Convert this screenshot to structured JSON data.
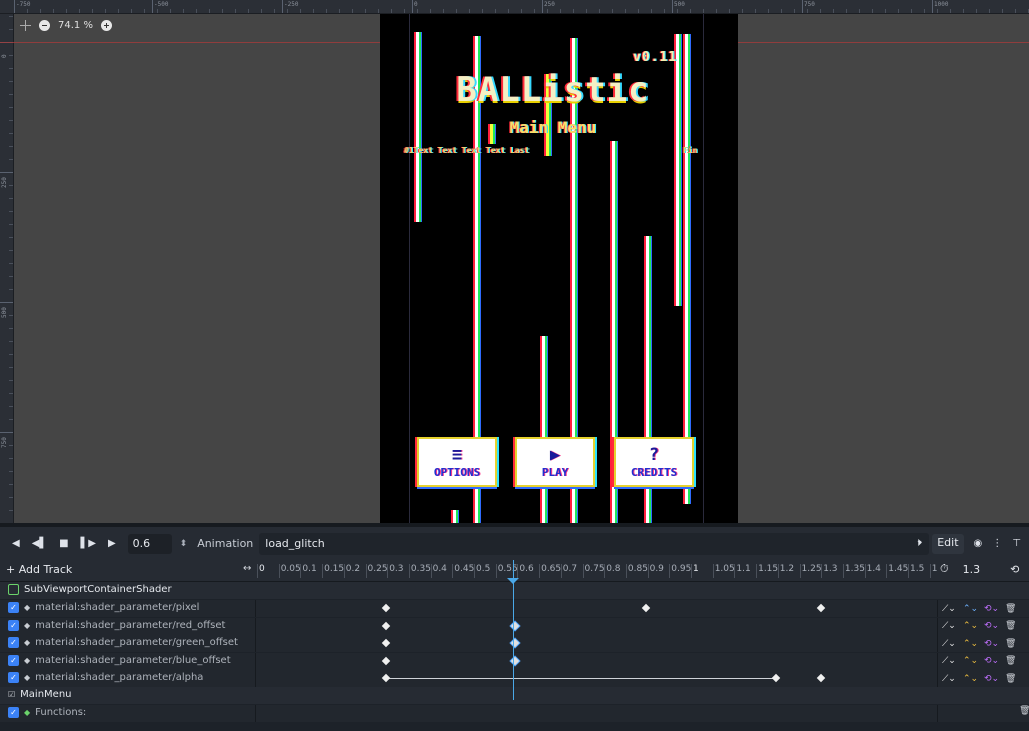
{
  "viewport": {
    "zoom_label": "74.1 %",
    "ruler_top_labels": [
      "-750",
      "-500",
      "-250",
      "0",
      "250",
      "500",
      "750",
      "1000"
    ],
    "ruler_left_labels": [
      "0",
      "250",
      "500",
      "750"
    ]
  },
  "game": {
    "version": "v0.11",
    "title": "BALListic",
    "subtitle": "Main Menu",
    "ticker": "#1Text Text Text Text Last",
    "ticker_end": "Fin",
    "buttons": [
      {
        "icon": "≡",
        "label": "OPTIONS"
      },
      {
        "icon": "▶",
        "label": "PLAY"
      },
      {
        "icon": "?",
        "label": "CREDITS"
      }
    ]
  },
  "anim_toolbar": {
    "current_time": "0.6",
    "animation_label": "Animation",
    "animation_name": "load_glitch",
    "edit_label": "Edit"
  },
  "track_header": {
    "add_track_label": "+ Add Track",
    "ticks": [
      "0",
      "0.05",
      "0.1",
      "0.15",
      "0.2",
      "0.25",
      "0.3",
      "0.35",
      "0.4",
      "0.45",
      "0.5",
      "0.55",
      "0.6",
      "0.65",
      "0.7",
      "0.75",
      "0.8",
      "0.85",
      "0.9",
      "0.95",
      "1",
      "1.05",
      "1.1",
      "1.15",
      "1.2",
      "1.25",
      "1.3",
      "1.35",
      "1.4",
      "1.45",
      "1.5",
      "1."
    ],
    "length_value": "1.3"
  },
  "tracks": {
    "group1": "SubViewportContainerShader",
    "group1_tracks": [
      "material:shader_parameter/pixel",
      "material:shader_parameter/red_offset",
      "material:shader_parameter/green_offset",
      "material:shader_parameter/blue_offset",
      "material:shader_parameter/alpha"
    ],
    "group2": "MainMenu",
    "group2_tracks": [
      "Functions:"
    ]
  }
}
